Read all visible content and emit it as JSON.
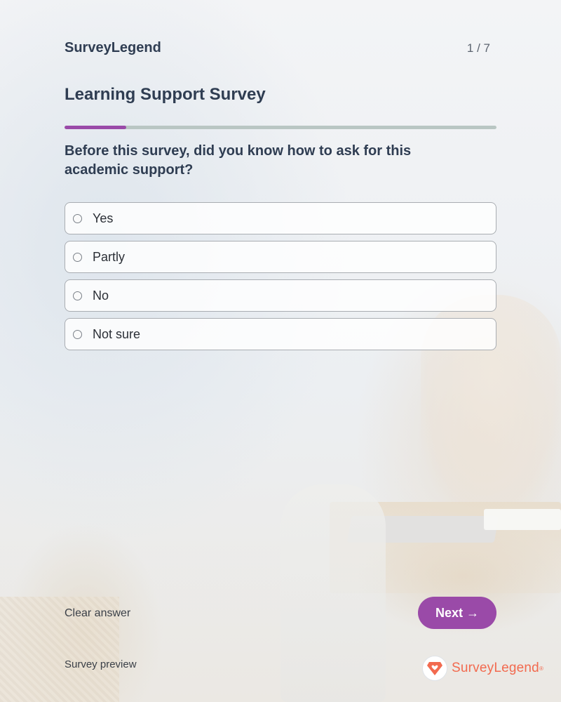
{
  "header": {
    "brand": "SurveyLegend",
    "page_counter": "1 / 7"
  },
  "survey": {
    "title": "Learning Support Survey",
    "progress_fraction": 0.143,
    "question": "Before this survey, did you know how to ask for this academic support?",
    "options": [
      {
        "label": "Yes",
        "selected": false
      },
      {
        "label": "Partly",
        "selected": false
      },
      {
        "label": "No",
        "selected": false
      },
      {
        "label": "Not sure",
        "selected": false
      }
    ]
  },
  "actions": {
    "clear_label": "Clear answer",
    "next_label": "Next →"
  },
  "footer": {
    "note": "Survey preview",
    "logo_text": "SurveyLegend",
    "logo_mark": "®"
  },
  "colors": {
    "accent": "#9a4aa8",
    "progress_track": "#b9c6c3",
    "logo": "#f26a4f"
  },
  "icons": {
    "logo_icon": "heart-diamond-icon",
    "radio_icon": "radio-circle-icon"
  }
}
